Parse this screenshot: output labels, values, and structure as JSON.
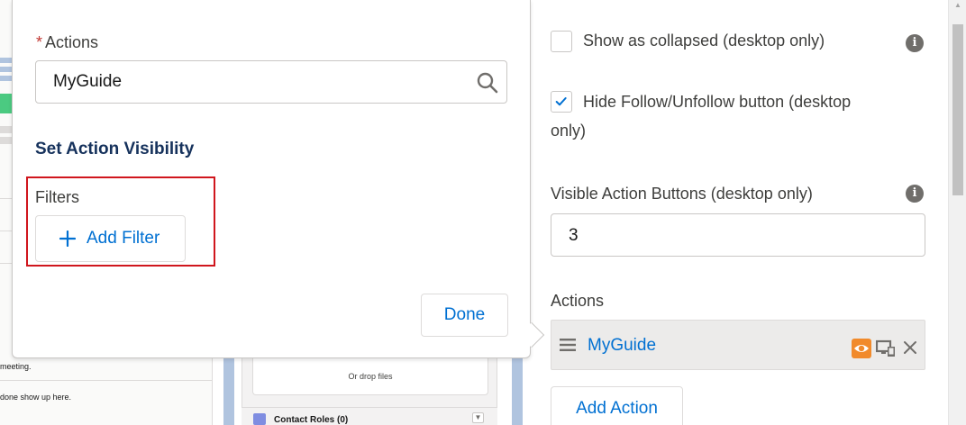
{
  "background": {
    "snippet_meeting": "meeting.",
    "snippet_done": "done show up here.",
    "drop_files": "Or drop files",
    "contact_roles": "Contact Roles (0)"
  },
  "popover": {
    "actions_label": "Actions",
    "required_marker": "*",
    "actions_value": "MyGuide",
    "section_title": "Set Action Visibility",
    "filters_label": "Filters",
    "add_filter_label": "Add Filter",
    "done_label": "Done"
  },
  "panel": {
    "show_collapsed": {
      "label": "Show as collapsed (desktop only)",
      "checked": false
    },
    "hide_follow": {
      "label": "Hide Follow/Unfollow button (desktop",
      "label_cont": "only)",
      "checked": true
    },
    "visible_action_buttons": {
      "label": "Visible Action Buttons (desktop only)",
      "value": "3"
    },
    "actions_label": "Actions",
    "action_items": [
      {
        "name": "MyGuide"
      }
    ],
    "add_action_label": "Add Action"
  },
  "colors": {
    "brand_blue": "#0070d2",
    "section_title": "#16325c",
    "required_red": "#c23934",
    "highlight_red": "#d0161d",
    "visibility_orange": "#f18a2b"
  },
  "icons": {
    "search": "search-icon",
    "plus": "plus-icon",
    "info": "info-icon",
    "drag": "drag-handle-icon",
    "eye": "eye-icon",
    "device": "device-icon",
    "close": "close-icon",
    "check": "check-icon"
  }
}
